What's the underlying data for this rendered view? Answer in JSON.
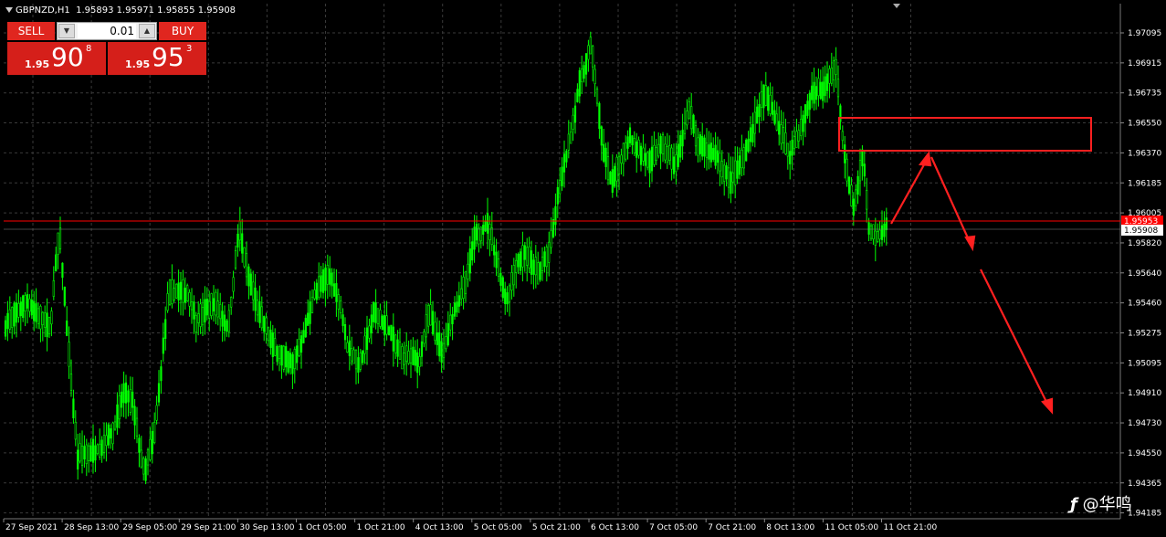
{
  "header": {
    "symbol": "GBPNZD,H1",
    "ohlc": "1.95893 1.95971 1.95855 1.95908"
  },
  "trade_panel": {
    "sell_label": "SELL",
    "buy_label": "BUY",
    "lot_value": "0.01",
    "sell_quote": {
      "prefix": "1.95",
      "big": "90",
      "sup": "8"
    },
    "buy_quote": {
      "prefix": "1.95",
      "big": "95",
      "sup": "3"
    }
  },
  "price_axis": {
    "labels": [
      "1.97095",
      "1.96915",
      "1.96735",
      "1.96550",
      "1.96370",
      "1.96185",
      "1.96005",
      "1.95820",
      "1.95640",
      "1.95460",
      "1.95275",
      "1.95095",
      "1.94910",
      "1.94730",
      "1.94550",
      "1.94365",
      "1.94185"
    ],
    "current_price_label": "1.95908",
    "ask_label": "1.95953"
  },
  "time_axis": {
    "labels": [
      "27 Sep 2021",
      "28 Sep 13:00",
      "29 Sep 05:00",
      "29 Sep 21:00",
      "30 Sep 13:00",
      "1 Oct 05:00",
      "1 Oct 21:00",
      "4 Oct 13:00",
      "5 Oct 05:00",
      "5 Oct 21:00",
      "6 Oct 13:00",
      "7 Oct 05:00",
      "7 Oct 21:00",
      "8 Oct 13:00",
      "11 Oct 05:00",
      "11 Oct 21:00"
    ]
  },
  "colors": {
    "background": "#000000",
    "candle": "#00ff00",
    "grid": "#3a3a3a",
    "ask_line": "#ff0000",
    "annotation": "#ff2020",
    "panel_red": "#d51f1a"
  },
  "watermark": {
    "text": "@华鸣"
  }
}
